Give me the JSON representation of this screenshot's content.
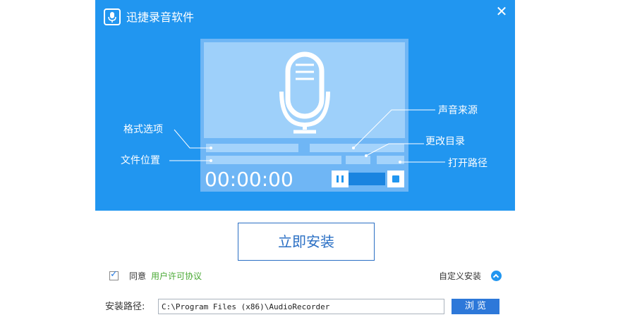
{
  "window": {
    "title": "迅捷录音软件",
    "close_glyph": "✕"
  },
  "device": {
    "timer": "00:00:00"
  },
  "labels": {
    "format": "格式选项",
    "file_location": "文件位置",
    "sound_source": "声音来源",
    "change_dir": "更改目录",
    "open_path": "打开路径"
  },
  "install_button": "立即安装",
  "agreement": {
    "checked": true,
    "prefix": "同意",
    "link": "用户许可协议"
  },
  "custom_install": "自定义安装",
  "install_path": {
    "label": "安装路径:",
    "value": "C:\\Program Files (x86)\\AudioRecorder"
  },
  "browse_button": "浏 览",
  "colors": {
    "banner": "#2196f0",
    "accent": "#2a6fc4",
    "link": "#47a832"
  },
  "icons": [
    "microphone-icon",
    "close-icon",
    "pause-icon",
    "stop-icon",
    "checkbox-icon",
    "chevron-up-icon"
  ]
}
